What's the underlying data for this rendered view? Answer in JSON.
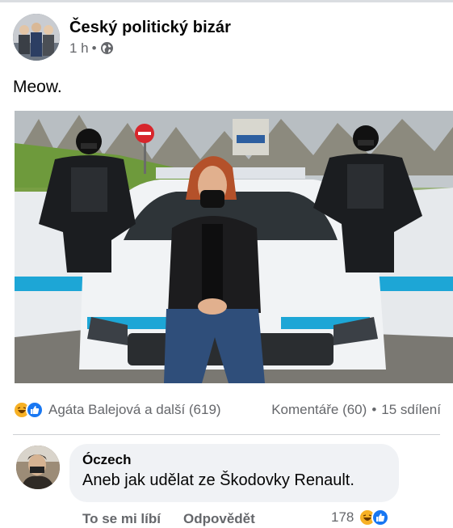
{
  "post": {
    "page_name": "Český politický bizár",
    "time": "1 h",
    "separator": "•",
    "privacy_icon": "globe-icon",
    "text": "Meow."
  },
  "reactions": {
    "icons": [
      "haha-icon",
      "like-icon"
    ],
    "names": "Agáta Balejová a další (619)",
    "comments": "Komentáře (60)",
    "separator": "•",
    "shares": "15 sdílení"
  },
  "comment": {
    "author": "Óczech",
    "text": "Aneb jak udělat ze Škodovky Renault.",
    "like_label": "To se mi líbí",
    "reply_label": "Odpovědět",
    "reaction_count": "178",
    "reaction_icons": [
      "haha-icon",
      "like-icon"
    ]
  },
  "colors": {
    "facebook_blue": "#1877f2",
    "haha_yellow": "#f7b125",
    "meta_gray": "#65676b",
    "bubble_gray": "#f0f2f5"
  }
}
